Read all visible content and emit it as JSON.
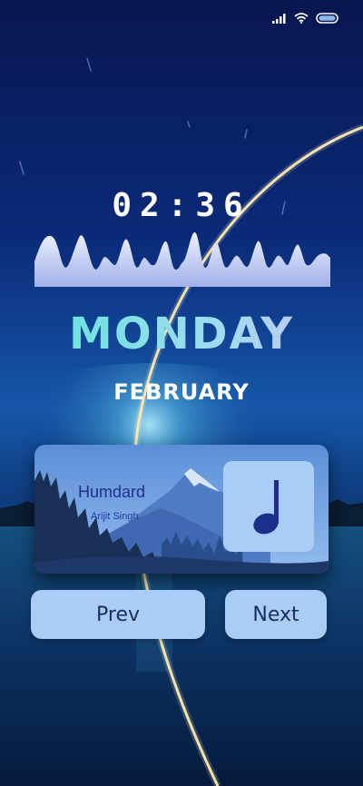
{
  "clock": {
    "time": "02:36"
  },
  "date": {
    "day": "MONDAY",
    "month": "FEBRUARY"
  },
  "now_playing": {
    "title": "Humdard",
    "artist": "Arijit Singh"
  },
  "controls": {
    "prev_label": "Prev",
    "next_label": "Next"
  },
  "status_icons": [
    "cellular-signal-icon",
    "wifi-icon",
    "battery-icon"
  ],
  "colors": {
    "accent_card": "#a9cdf6",
    "title_text": "#1e2f8c",
    "day_gradient": [
      "#57e6d6",
      "#cdbdf5"
    ]
  }
}
